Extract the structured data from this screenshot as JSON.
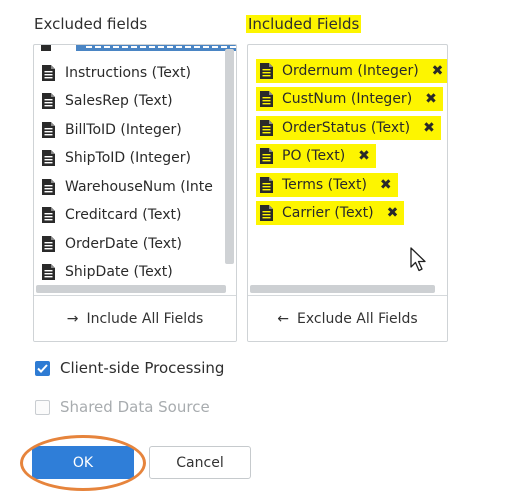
{
  "excluded": {
    "label": "Excluded fields",
    "fields": [
      "Instructions (Text)",
      "SalesRep (Text)",
      "BillToID (Integer)",
      "ShipToID (Integer)",
      "WarehouseNum (Inte",
      "Creditcard (Text)",
      "OrderDate (Text)",
      "ShipDate (Text)"
    ],
    "action": {
      "arrow": "→",
      "label": "Include All Fields"
    }
  },
  "included": {
    "label": "Included Fields",
    "fields": [
      "Ordernum (Integer)",
      "CustNum (Integer)",
      "OrderStatus (Text)",
      "PO (Text)",
      "Terms (Text)",
      "Carrier (Text)"
    ],
    "remove_icon": "✖",
    "action": {
      "arrow": "←",
      "label": "Exclude All Fields"
    }
  },
  "options": {
    "client_side": {
      "label": "Client-side Processing",
      "checked": true
    },
    "shared_source": {
      "label": "Shared Data Source",
      "checked": false
    }
  },
  "buttons": {
    "ok": "OK",
    "cancel": "Cancel"
  },
  "colors": {
    "highlight": "#fdf500",
    "accent": "#2f7ed8",
    "ring": "#e6843c"
  },
  "icons": {
    "field": "document-icon",
    "cursor": "mouse-pointer-icon",
    "remove": "close-icon"
  }
}
